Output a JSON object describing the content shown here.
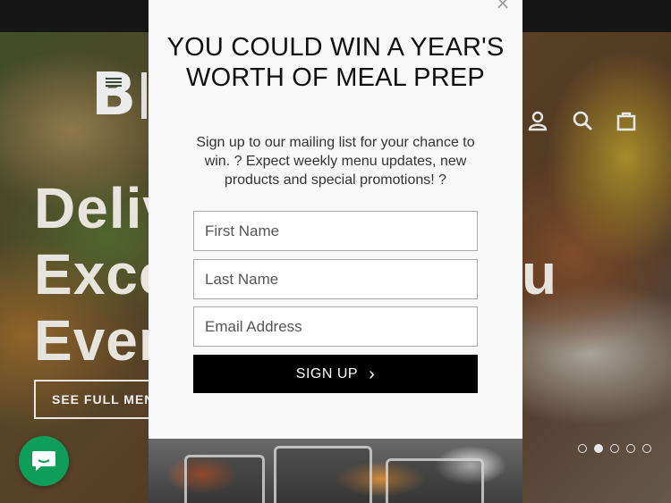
{
  "hero": {
    "heading_lines": [
      "Deliv",
      "Exce",
      "Ever"
    ],
    "heading_line2_tail": "u",
    "button_label": "SEE FULL MENU"
  },
  "nav": {
    "icons": [
      "user-icon",
      "search-icon",
      "cart-icon"
    ]
  },
  "slider": {
    "dot_count": 5,
    "active_index": 1
  },
  "popup": {
    "close_label": "×",
    "title": "YOU COULD WIN A YEAR'S WORTH OF MEAL PREP",
    "subtitle": "Sign up to our mailing list for your chance to win. ? Expect weekly menu updates, new products and special promotions! ?",
    "first_name_placeholder": "First Name",
    "last_name_placeholder": "Last Name",
    "email_placeholder": "Email Address",
    "signup_label": "SIGN UP",
    "signup_arrow": "›"
  },
  "colors": {
    "popup_bg": "#f8f8f8",
    "button_bg": "#000000",
    "chat_green": "#0f9d5a",
    "topbar": "#161616"
  }
}
